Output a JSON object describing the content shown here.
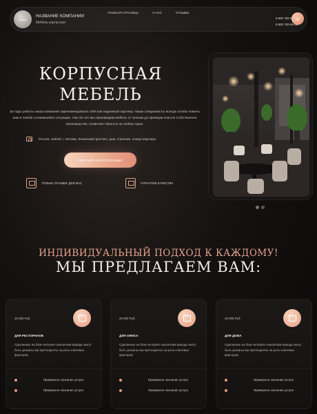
{
  "header": {
    "logo_text": "LOGO",
    "company_name": "НАЗВАНИЕ КОМПАНИИ",
    "company_sub": "Мебель корпусная",
    "nav": [
      "ГЛАВНАЯ СТРАНИЦА",
      "О НАС",
      "ОТЗЫВЫ"
    ],
    "phones": [
      "8 800 700-00-00",
      "8 800 700-00-00"
    ],
    "call_icon": "phone-icon"
  },
  "hero": {
    "title_line1": "КОРПУСНАЯ",
    "title_line2": "МЕБЕЛЬ",
    "description": "За годы работы наша компания зарекомендовала себя как надежный партнер. Наши специалисты всегда готовы помочь вам в любой сложившейся ситуации. Уже 25 лет мы производим мебель от эконом до премиум класса! Собственное производство, позволяет браться за любые идеи.",
    "address": "Россия, 125040, г. Москва, Ленинский проспект, дом, строение, номер квартиры",
    "cta_label": "ПОЛУЧИТЬ КОНСУЛЬТАЦИЮ",
    "features": [
      "ТОЛЬКО ЛУЧШЕЕ ДЛЯ ВАС",
      "ГАРАНТИЯ КАЧЕСТВА"
    ]
  },
  "section": {
    "top": "ИНДИВИДУАЛЬНЫЙ ПОДХОД К КАЖДОМУ!",
    "main": "МЫ ПРЕДЛАГАЕМ ВАМ:"
  },
  "cards": [
    {
      "price": "20 000 Руб.",
      "title": "ДЛЯ РЕСТОРАНОВ",
      "desc": "Сделанные на базе интернет-аналитики выводы могут быть указаны как претенденты на роль ключевых факторов.",
      "items": [
        "Примерное описание услуги",
        "Примерное описание услуги"
      ]
    },
    {
      "price": "20 000 Руб.",
      "title": "ДЛЯ ОФИСА",
      "desc": "Сделанные на базе интернет-аналитики выводы могут быть указаны как претенденты на роль ключевых факторов.",
      "items": [
        "Примерное описание услуги",
        "Примерное описание услуги"
      ]
    },
    {
      "price": "20 000 Руб.",
      "title": "ДЛЯ ДОМА",
      "desc": "Сделанные на базе интернет-аналитики выводы могут быть указаны как претенденты на роль ключевых факторов.",
      "items": [
        "Примерное описание услуги",
        "Примерное описание услуги"
      ]
    }
  ],
  "colors": {
    "accent": "#e59b7e",
    "accent_light": "#f6d5bd",
    "background": "#0b0a09"
  }
}
